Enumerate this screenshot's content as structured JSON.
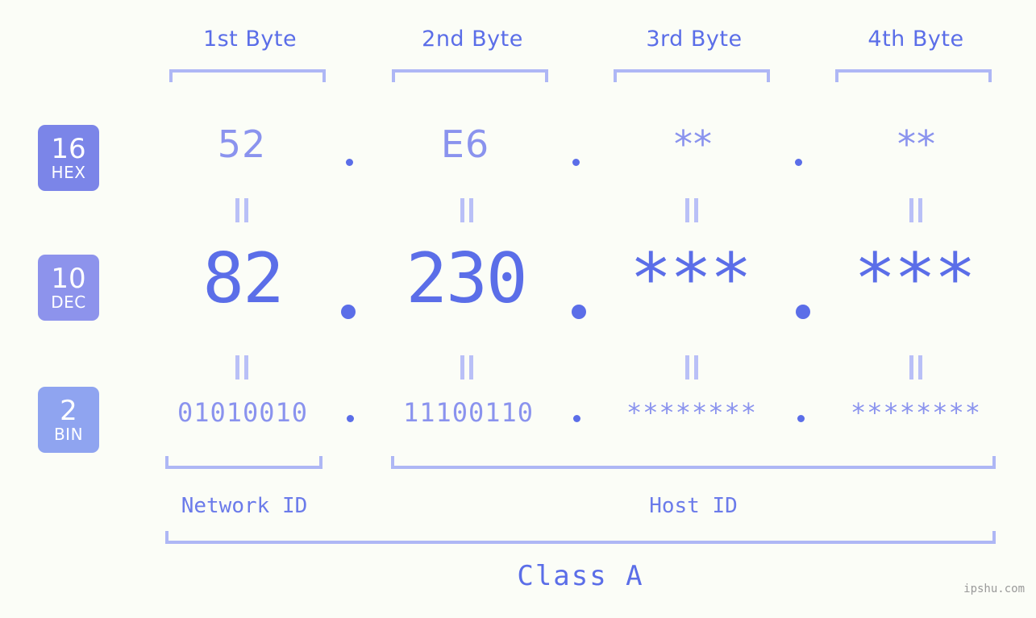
{
  "headers": {
    "bytes": [
      "1st Byte",
      "2nd Byte",
      "3rd Byte",
      "4th Byte"
    ]
  },
  "bases": [
    {
      "number": "16",
      "abbr": "HEX",
      "color": "#7b85e8"
    },
    {
      "number": "10",
      "abbr": "DEC",
      "color": "#8d93ec"
    },
    {
      "number": "2",
      "abbr": "BIN",
      "color": "#8fa4f0"
    }
  ],
  "rows": {
    "hex": {
      "values": [
        "52",
        "E6",
        "**",
        "**"
      ]
    },
    "dec": {
      "values": [
        "82",
        "230",
        "***",
        "***"
      ]
    },
    "bin": {
      "values": [
        "01010010",
        "11100110",
        "********",
        "********"
      ]
    }
  },
  "separators": {
    "dot": ".",
    "equals": "="
  },
  "footer": {
    "network_id": "Network ID",
    "host_id": "Host ID",
    "class": "Class A",
    "watermark": "ipshu.com"
  },
  "palette": {
    "background": "#fbfdf7",
    "accent": "#5b6ee8",
    "accent_light": "#8a93ee",
    "bracket": "#aeb7f5",
    "equals": "#b9c0f7",
    "watermark": "#9a9a9a"
  }
}
